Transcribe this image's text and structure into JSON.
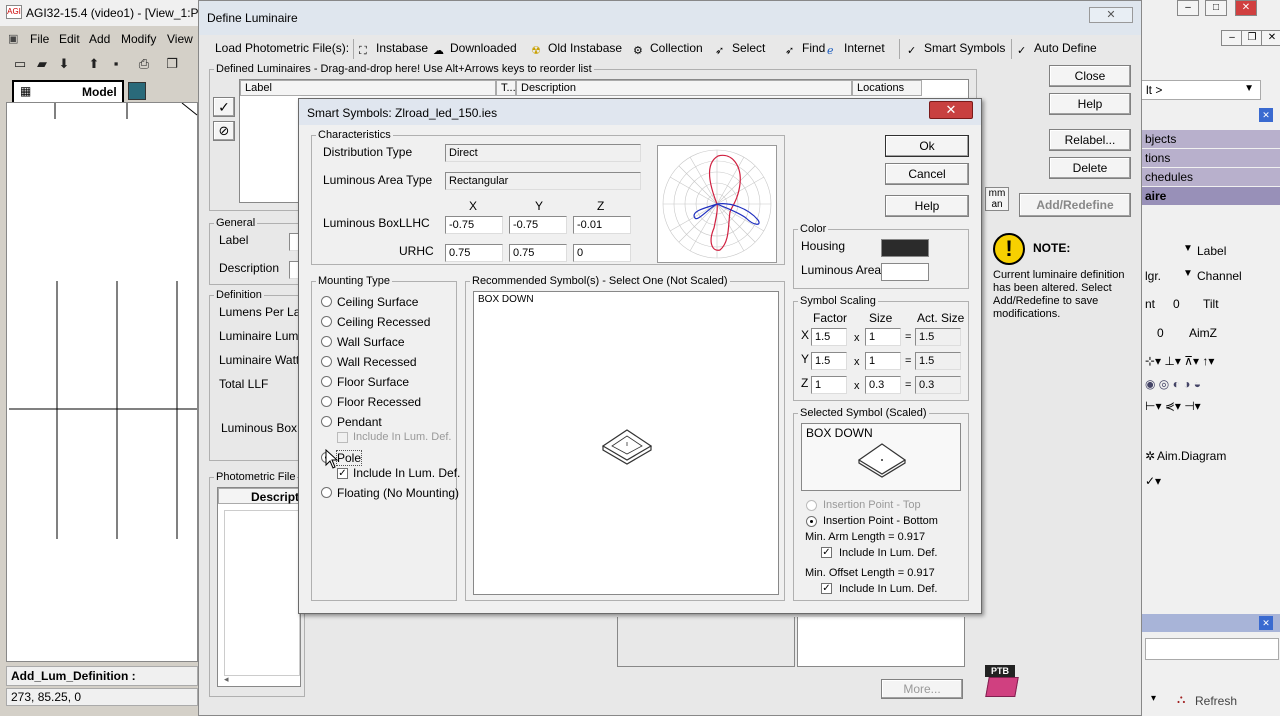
{
  "app": {
    "title": "AGI32-15.4 (video1) - [View_1:Pl",
    "logo": "AGI",
    "menu": [
      "File",
      "Edit",
      "Add",
      "Modify",
      "View"
    ],
    "tab_model": "Model",
    "status_command": "Add_Lum_Definition :",
    "status_coords": "273, 85.25, 0"
  },
  "right_panel": {
    "dropdown": "lt >",
    "sections": [
      "bjects",
      "tions",
      "chedules",
      "aire"
    ],
    "rows": [
      {
        "a": "Label"
      },
      {
        "a": "lgr.",
        "b": "Channel"
      },
      {
        "a": "nt",
        "b": "0",
        "c": "Tilt"
      },
      {
        "a": "0",
        "b": "AimZ"
      }
    ],
    "aim_diagram": "Aim.Diagram",
    "refresh": "Refresh"
  },
  "define_luminaire": {
    "title": "Define Luminaire",
    "toolbar": {
      "load_label": "Load Photometric File(s):",
      "instabase": "Instabase",
      "downloaded": "Downloaded",
      "old_instabase": "Old Instabase",
      "collection": "Collection",
      "select": "Select",
      "find": "Find",
      "internet": "Internet",
      "smart_symbols": "Smart Symbols",
      "auto_define": "Auto Define"
    },
    "defined_group": "Defined Luminaires - Drag-and-drop here!  Use Alt+Arrows keys to reorder list",
    "columns": {
      "label": "Label",
      "t": "T...",
      "description": "Description",
      "locations": "Locations"
    },
    "general": {
      "group": "General",
      "label": "Label",
      "description": "Description"
    },
    "definition": {
      "group": "Definition",
      "lumens": "Lumens Per Lamp",
      "luminaire_lumens": "Luminaire Lumen",
      "luminaire_watts": "Luminaire Watts",
      "total_llf": "Total LLF",
      "luminous_box": "Luminous Box:"
    },
    "photometric_file": {
      "group": "Photometric File",
      "descript": "Descript"
    },
    "units": {
      "mm": "mm",
      "an": "an"
    },
    "buttons": {
      "close": "Close",
      "help": "Help",
      "relabel": "Relabel...",
      "delete": "Delete",
      "add_redefine": "Add/Redefine",
      "more": "More..."
    },
    "note": {
      "title": "NOTE:",
      "text1": "Current luminaire definition",
      "text2": "has been altered. Select",
      "text3": "Add/Redefine to save",
      "text4": "modifications."
    },
    "ptb": "PTB"
  },
  "smart_symbols": {
    "title": "Smart Symbols: Zlroad_led_150.ies",
    "close_icon": "close-icon",
    "characteristics": {
      "group": "Characteristics",
      "distribution_label": "Distribution Type",
      "distribution_value": "Direct",
      "area_label": "Luminous Area Type",
      "area_value": "Rectangular",
      "x": "X",
      "y": "Y",
      "z": "Z",
      "box_label": "Luminous Box:",
      "llhc": "LLHC",
      "urhc": "URHC",
      "llhc_x": "-0.75",
      "llhc_y": "-0.75",
      "llhc_z": "-0.01",
      "urhc_x": "0.75",
      "urhc_y": "0.75",
      "urhc_z": "0"
    },
    "buttons": {
      "ok": "Ok",
      "cancel": "Cancel",
      "help": "Help"
    },
    "color": {
      "group": "Color",
      "housing": "Housing",
      "housing_color": "#2b2b2b",
      "luminous_area": "Luminous Area",
      "luminous_color": "#ffffff"
    },
    "mounting": {
      "group": "Mounting Type",
      "options": [
        "Ceiling Surface",
        "Ceiling Recessed",
        "Wall Surface",
        "Wall Recessed",
        "Floor Surface",
        "Floor Recessed",
        "Pendant"
      ],
      "include_pendant": "Include In Lum. Def.",
      "pole": "Pole",
      "include_pole": "Include In Lum. Def.",
      "floating": "Floating (No Mounting)",
      "selected": "Pole"
    },
    "recommended": {
      "group": "Recommended Symbol(s) - Select One (Not Scaled)",
      "item": "BOX DOWN"
    },
    "scaling": {
      "group": "Symbol Scaling",
      "factor": "Factor",
      "size": "Size",
      "act_size": "Act. Size",
      "rows": [
        {
          "axis": "X",
          "factor": "1.5",
          "size": "1",
          "act": "1.5"
        },
        {
          "axis": "Y",
          "factor": "1.5",
          "size": "1",
          "act": "1.5"
        },
        {
          "axis": "Z",
          "factor": "1",
          "size": "0.3",
          "act": "0.3"
        }
      ],
      "times": "x",
      "equals": "="
    },
    "selected": {
      "group": "Selected Symbol (Scaled)",
      "name": "BOX DOWN",
      "insertion_top": "Insertion Point - Top",
      "insertion_bottom": "Insertion Point - Bottom",
      "min_arm": "Min. Arm Length = 0.917",
      "include_arm": "Include In Lum. Def.",
      "min_offset": "Min. Offset Length = 0.917",
      "include_offset": "Include In Lum. Def."
    }
  }
}
